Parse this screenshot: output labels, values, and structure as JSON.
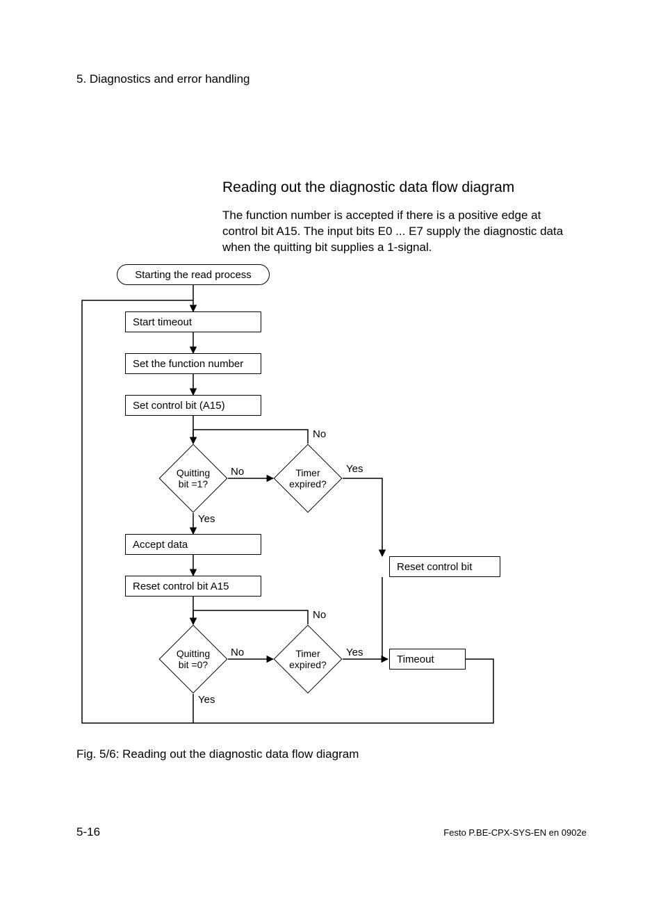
{
  "header": {
    "section": "5.   Diagnostics and error handling",
    "title": "Reading out the diagnostic data flow diagram",
    "body": "The function number is accepted if there is a positive edge at control bit A15. The input bits E0 ... E7 supply the diagnostic data when the quitting bit supplies a 1-signal."
  },
  "flow": {
    "terminator": "Starting the read process",
    "p_start_timeout": "Start timeout",
    "p_set_fn": "Set the function number",
    "p_set_ctrl": "Set control bit (A15)",
    "d_quit1": "Quitting\nbit =1?",
    "d_timer1": "Timer\nexpired?",
    "p_accept": "Accept data",
    "p_reset_a15": "Reset control bit A15",
    "p_reset_ctrl": "Reset control bit",
    "d_quit0": "Quitting\nbit =0?",
    "d_timer2": "Timer\nexpired?",
    "p_timeout": "Timeout",
    "labels": {
      "yes": "Yes",
      "no": "No"
    }
  },
  "caption": "Fig. 5/6:    Reading out the diagnostic data flow diagram",
  "footer": {
    "page": "5-16",
    "right": "Festo  P.BE-CPX-SYS-EN  en 0902e"
  }
}
